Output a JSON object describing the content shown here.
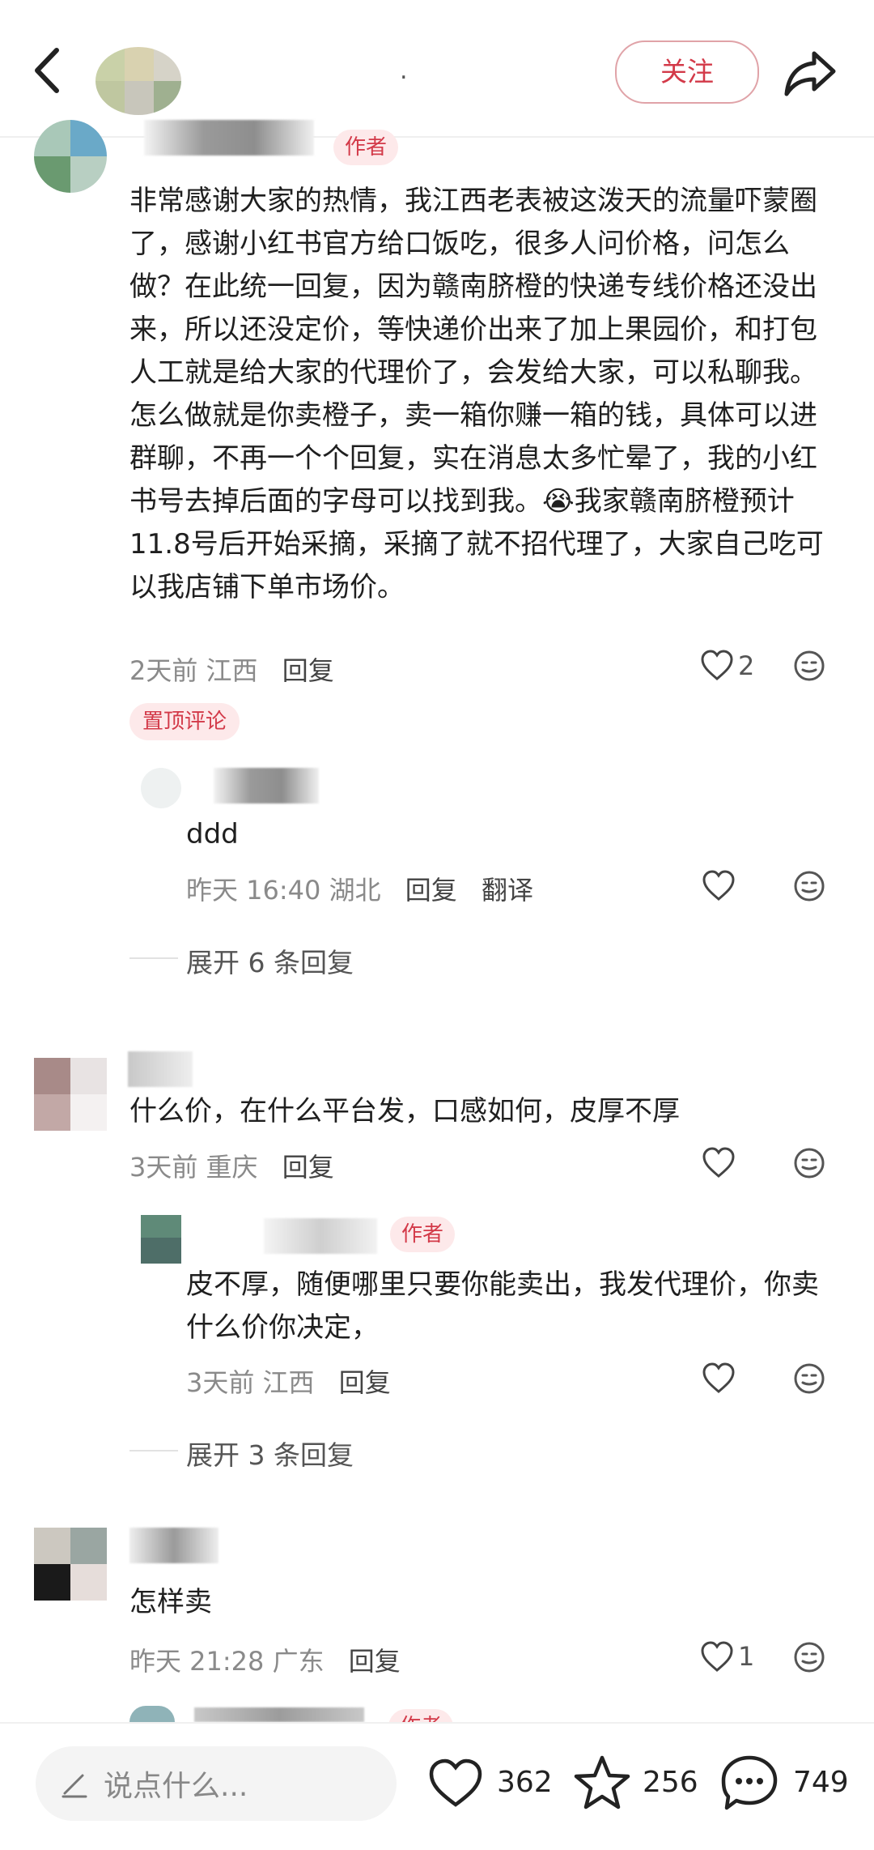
{
  "header": {
    "follow_label": "关注",
    "author_name": "."
  },
  "comments": [
    {
      "author_tag": "作者",
      "text": "非常感谢大家的热情，我江西老表被这泼天的流量吓蒙圈了，感谢小红书官方给口饭吃，很多人问价格，问怎么做？在此统一回复，因为赣南脐橙的快递专线价格还没出来，所以还没定价，等快递价出来了加上果园价，和打包人工就是给大家的代理价了，会发给大家，可以私聊我。怎么做就是你卖橙子，卖一箱你赚一箱的钱，具体可以进群聊，不再一个个回复，实在消息太多忙晕了，我的小红书号去掉后面的字母可以找到我。😭我家赣南脐橙预计11.8号后开始采摘，采摘了就不招代理了，大家自己吃可以我店铺下单市场价。",
      "time": "2天前",
      "location": "江西",
      "reply_label": "回复",
      "likes": "2",
      "pinned_label": "置顶评论",
      "reply": {
        "text": "ddd",
        "time": "昨天 16:40",
        "location": "湖北",
        "reply_label": "回复",
        "translate_label": "翻译"
      },
      "expand_label": "展开 6 条回复"
    },
    {
      "text": "什么价，在什么平台发，口感如何，皮厚不厚",
      "time": "3天前",
      "location": "重庆",
      "reply_label": "回复",
      "reply": {
        "author_tag": "作者",
        "text": "皮不厚，随便哪里只要你能卖出，我发代理价，你卖什么价你决定，",
        "time": "3天前",
        "location": "江西",
        "reply_label": "回复"
      },
      "expand_label": "展开 3 条回复"
    },
    {
      "text": "怎样卖",
      "time": "昨天 21:28",
      "location": "广东",
      "reply_label": "回复",
      "likes": "1"
    },
    {
      "author_tag": "作者"
    }
  ],
  "bottom_bar": {
    "input_placeholder": "说点什么...",
    "likes": "362",
    "favorites": "256",
    "comments": "749"
  },
  "colors": {
    "accent": "#d33a49",
    "tag_bg": "#fde9ea",
    "muted": "#8a8a8a"
  }
}
